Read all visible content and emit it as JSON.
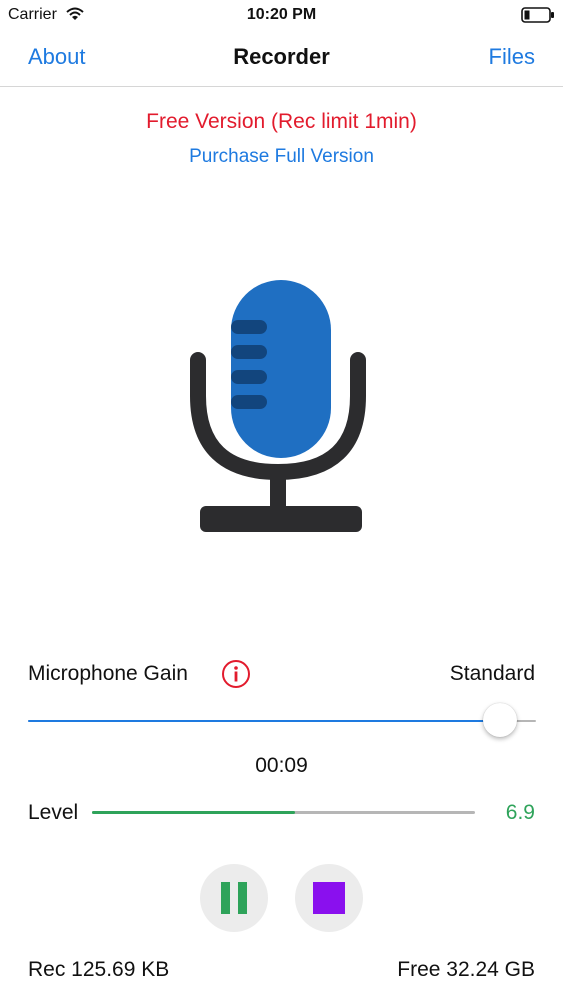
{
  "status_bar": {
    "carrier": "Carrier",
    "time": "10:20 PM"
  },
  "nav": {
    "left": "About",
    "title": "Recorder",
    "right": "Files"
  },
  "banner": {
    "free_version": "Free Version (Rec limit 1min)",
    "purchase": "Purchase Full Version"
  },
  "gain": {
    "label": "Microphone Gain",
    "value": "Standard",
    "level": 0.96
  },
  "timer": "00:09",
  "level": {
    "label": "Level",
    "value": "6.9",
    "fraction": 0.53
  },
  "footer": {
    "rec_size": "Rec 125.69 KB",
    "free_space": "Free 32.24 GB"
  },
  "colors": {
    "accent": "#1e7ae0",
    "warning_red": "#e21b2d",
    "level_green": "#2ea35a",
    "stop_purple": "#8a10ee"
  },
  "icons": {
    "status": [
      "wifi-icon",
      "battery-icon"
    ],
    "illustration": "microphone-icon",
    "gain_info": "info-icon",
    "controls": [
      "pause-icon",
      "stop-icon"
    ]
  }
}
